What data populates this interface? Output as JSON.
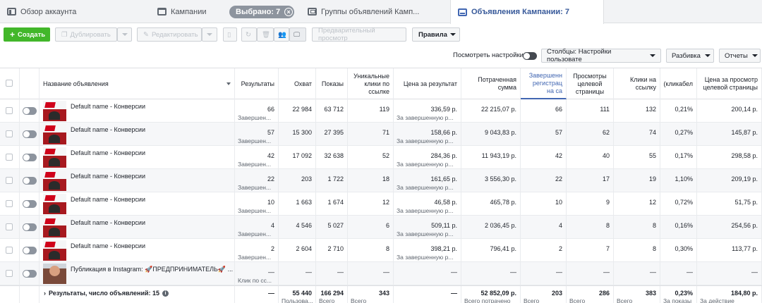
{
  "tabs": {
    "overview": "Обзор аккаунта",
    "campaigns": "Кампании",
    "selected": "Выбрано: 7",
    "adsets": "Группы объявлений Камп...",
    "ads": "Объявления Кампании: 7"
  },
  "toolbar": {
    "create": "Создать",
    "duplicate": "Дублировать",
    "edit": "Редактировать",
    "preview": "Предварительный просмотр",
    "rules": "Правила"
  },
  "controls": {
    "view_settings": "Посмотреть настройки",
    "columns": "Столбцы: Настройки пользовате",
    "breakdown": "Разбивка",
    "reports": "Отчеты"
  },
  "columns": [
    "Название объявления",
    "Результаты",
    "Охват",
    "Показы",
    "Уникальные клики по ссылке",
    "Цена за результат",
    "Потраченная сумма",
    "Завершенн регистрац на са",
    "Просмотры целевой страницы",
    "Клики на ссылку",
    "(кликабел",
    "Цена за просмотр целевой страницы"
  ],
  "rows": [
    {
      "name": "Default name - Конверсии",
      "results": "66",
      "results_sub": "Завершен...",
      "reach": "22 984",
      "impr": "63 712",
      "uclicks": "119",
      "cpr": "336,59 р.",
      "cpr_sub": "За завершенную р...",
      "spent": "22 215,07 р.",
      "reg": "66",
      "lpv": "111",
      "clicks": "132",
      "ctr": "0,21%",
      "cplpv": "200,14 р."
    },
    {
      "name": "Default name - Конверсии",
      "results": "57",
      "results_sub": "Завершен...",
      "reach": "15 300",
      "impr": "27 395",
      "uclicks": "71",
      "cpr": "158,66 р.",
      "cpr_sub": "За завершенную р...",
      "spent": "9 043,83 р.",
      "reg": "57",
      "lpv": "62",
      "clicks": "74",
      "ctr": "0,27%",
      "cplpv": "145,87 р."
    },
    {
      "name": "Default name - Конверсии",
      "results": "42",
      "results_sub": "Завершен...",
      "reach": "17 092",
      "impr": "32 638",
      "uclicks": "52",
      "cpr": "284,36 р.",
      "cpr_sub": "За завершенную р...",
      "spent": "11 943,19 р.",
      "reg": "42",
      "lpv": "40",
      "clicks": "55",
      "ctr": "0,17%",
      "cplpv": "298,58 р."
    },
    {
      "name": "Default name - Конверсии",
      "results": "22",
      "results_sub": "Завершен...",
      "reach": "203",
      "impr": "1 722",
      "uclicks": "18",
      "cpr": "161,65 р.",
      "cpr_sub": "За завершенную р...",
      "spent": "3 556,30 р.",
      "reg": "22",
      "lpv": "17",
      "clicks": "19",
      "ctr": "1,10%",
      "cplpv": "209,19 р."
    },
    {
      "name": "Default name - Конверсии",
      "results": "10",
      "results_sub": "Завершен...",
      "reach": "1 663",
      "impr": "1 674",
      "uclicks": "12",
      "cpr": "46,58 р.",
      "cpr_sub": "За завершенную р...",
      "spent": "465,78 р.",
      "reg": "10",
      "lpv": "9",
      "clicks": "12",
      "ctr": "0,72%",
      "cplpv": "51,75 р."
    },
    {
      "name": "Default name - Конверсии",
      "results": "4",
      "results_sub": "Завершен...",
      "reach": "4 546",
      "impr": "5 027",
      "uclicks": "6",
      "cpr": "509,11 р.",
      "cpr_sub": "За завершенную р...",
      "spent": "2 036,45 р.",
      "reg": "4",
      "lpv": "8",
      "clicks": "8",
      "ctr": "0,16%",
      "cplpv": "254,56 р."
    },
    {
      "name": "Default name - Конверсии",
      "results": "2",
      "results_sub": "Завершен...",
      "reach": "2 604",
      "impr": "2 710",
      "uclicks": "8",
      "cpr": "398,21 р.",
      "cpr_sub": "За завершенную р...",
      "spent": "796,41 р.",
      "reg": "2",
      "lpv": "7",
      "clicks": "8",
      "ctr": "0,30%",
      "cplpv": "113,77 р."
    },
    {
      "name": "Публикация в Instagram: 🚀ПРЕДПРИНИМАТЕЛЬ🚀 ...",
      "results": "—",
      "results_sub": "Клик по сс...",
      "reach": "—",
      "impr": "—",
      "uclicks": "—",
      "cpr": "—",
      "cpr_sub": "",
      "spent": "—",
      "reg": "—",
      "lpv": "—",
      "clicks": "—",
      "ctr": "—",
      "cplpv": "—"
    }
  ],
  "footer": {
    "summary": "Результаты, число объявлений: 15",
    "info": "i",
    "results": "—",
    "results_sub": "",
    "reach": "55 440",
    "reach_sub": "Пользова...",
    "impr": "166 294",
    "impr_sub": "Всего",
    "uclicks": "343",
    "uclicks_sub": "Всего",
    "cpr": "—",
    "cpr_sub": "",
    "spent": "52 852,09 р.",
    "spent_sub": "Всего потрачено",
    "reg": "203",
    "reg_sub": "Всего",
    "lpv": "286",
    "lpv_sub": "Всего",
    "clicks": "383",
    "clicks_sub": "Всего",
    "ctr": "0,23%",
    "ctr_sub": "За показы",
    "cplpv": "184,80 р.",
    "cplpv_sub": "За действие"
  }
}
